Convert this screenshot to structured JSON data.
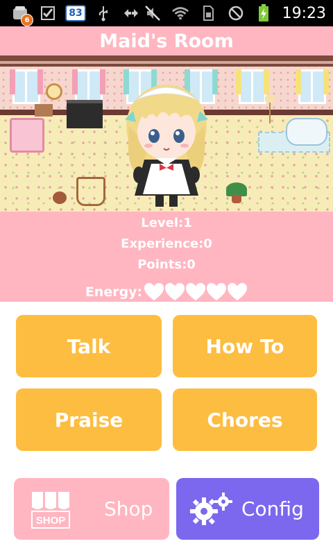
{
  "status_bar": {
    "notification_count": "6",
    "battery_level_badge": "83",
    "time": "19:23"
  },
  "title": "Maid's Room",
  "stats": {
    "level": "Level:1",
    "experience": "Experience:0",
    "points": "Points:0",
    "energy_label": "Energy:",
    "energy_hearts": 5
  },
  "buttons": {
    "talk": "Talk",
    "how_to": "How To",
    "praise": "Praise",
    "chores": "Chores",
    "shop": "Shop",
    "shop_icon_text": "SHOP",
    "config": "Config"
  },
  "colors": {
    "pink": "#ffb6c1",
    "orange_button": "#fdbd40",
    "config_purple": "#7b68ee"
  }
}
